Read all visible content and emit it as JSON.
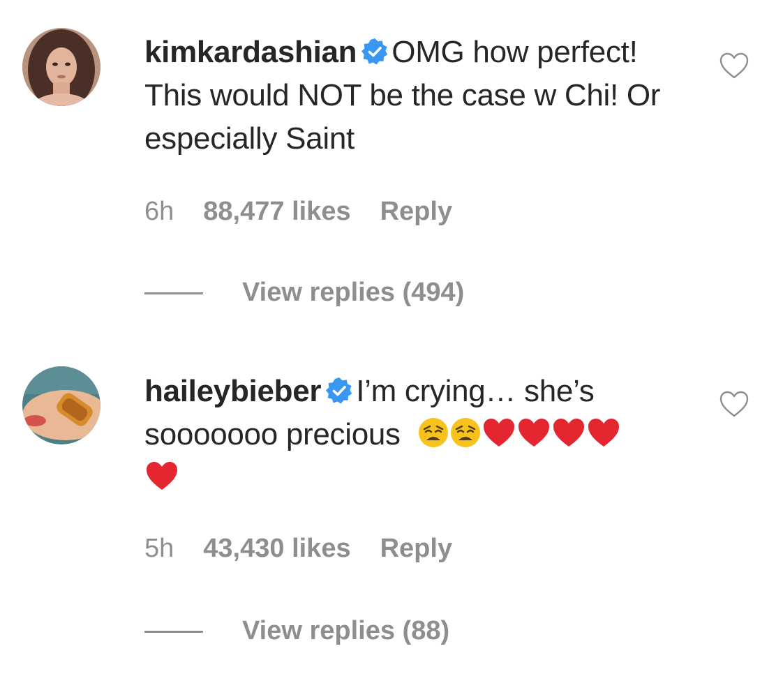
{
  "comments": [
    {
      "username": "kimkardashian",
      "text_first": "OMG how",
      "text_rest": "perfect! This would NOT be the case w Chi! Or especially Saint",
      "time": "6h",
      "likes": "88,477 likes",
      "reply": "Reply",
      "view_replies": "View replies (494)"
    },
    {
      "username": "haileybieber",
      "text_first": "I’m crying… she’s",
      "text_rest": "sooooooo precious",
      "emojis": [
        "weary-face",
        "weary-face",
        "red-heart",
        "red-heart",
        "red-heart",
        "red-heart",
        "red-heart"
      ],
      "time": "5h",
      "likes": "43,430 likes",
      "reply": "Reply",
      "view_replies": "View replies (88)"
    }
  ],
  "colors": {
    "text": "#262626",
    "secondary": "#8e8e8e",
    "verified": "#3897f0",
    "heart_emoji": "#e3262f",
    "weary_emoji": "#f7c21b"
  },
  "icons": {
    "verified": "verified-badge-icon",
    "like": "heart-outline-icon"
  }
}
